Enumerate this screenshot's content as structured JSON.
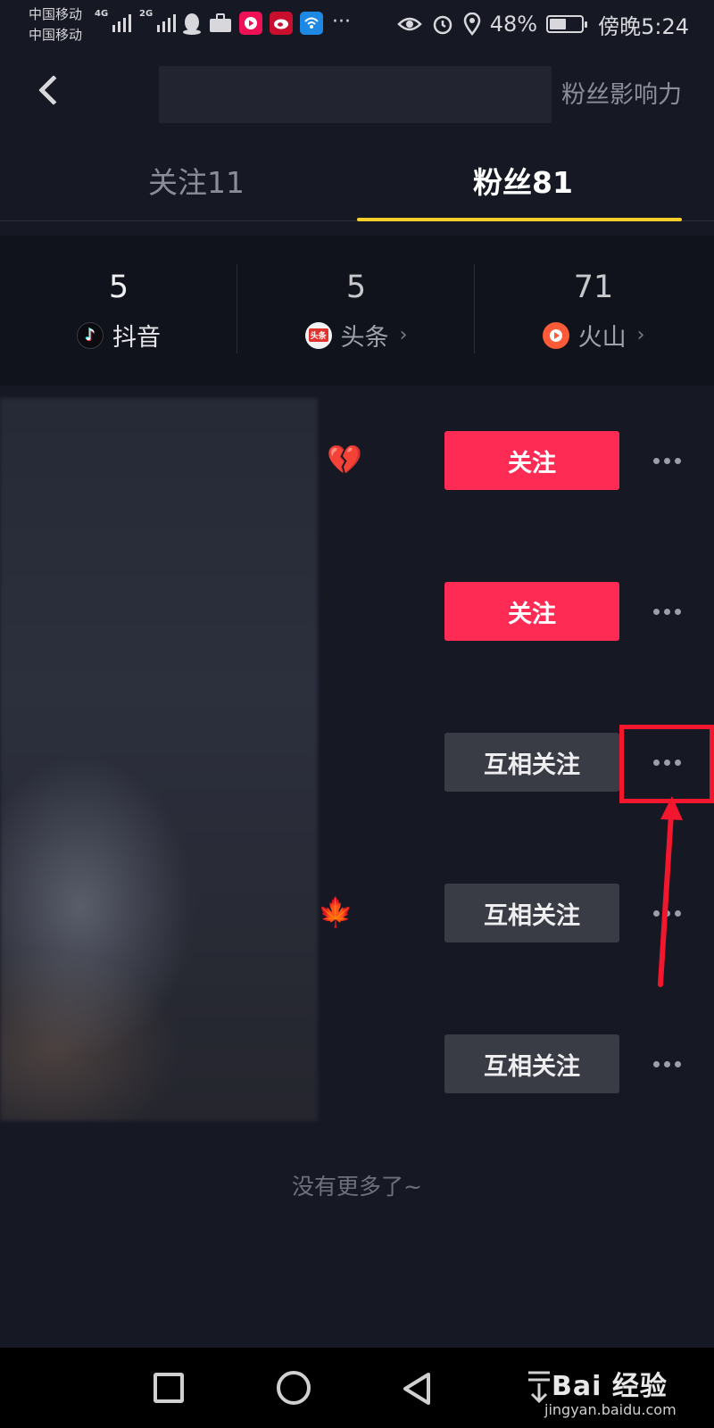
{
  "status_bar": {
    "carrier_1": "中国移动",
    "carrier_2": "中国移动",
    "net_1": "4G",
    "net_2": "2G",
    "battery": "48%",
    "time": "傍晚5:24",
    "more": "···",
    "icons": [
      "qq-icon",
      "briefcase-icon",
      "video-app-icon",
      "weibo-icon",
      "wifi-app-icon",
      "eye-icon",
      "alarm-icon",
      "location-icon",
      "battery-icon"
    ]
  },
  "header": {
    "influence_link": "粉丝影响力"
  },
  "tabs": [
    {
      "label": "关注11",
      "active": false
    },
    {
      "label": "粉丝81",
      "active": true
    }
  ],
  "accent_colors": {
    "tab_indicator": "#f6cf2b",
    "follow_button": "#fe2c55",
    "highlight": "#f2162e"
  },
  "stats": [
    {
      "count": "5",
      "platform": "抖音",
      "icon": "douyin-icon"
    },
    {
      "count": "5",
      "platform": "头条",
      "icon": "toutiao-icon",
      "icon_text": "头条"
    },
    {
      "count": "71",
      "platform": "火山",
      "icon": "huoshan-icon"
    }
  ],
  "rows": [
    {
      "emoji": "💔",
      "button": "关注",
      "style": "follow"
    },
    {
      "emoji": "",
      "button": "关注",
      "style": "follow"
    },
    {
      "emoji": "",
      "button": "互相关注",
      "style": "mutual",
      "more_highlighted": true
    },
    {
      "emoji": "🍁",
      "button": "互相关注",
      "style": "mutual"
    },
    {
      "emoji": "",
      "button": "互相关注",
      "style": "mutual"
    }
  ],
  "footer_text": "没有更多了~",
  "watermark": {
    "brand": "Bai 经验",
    "url": "jingyan.baidu.com"
  }
}
